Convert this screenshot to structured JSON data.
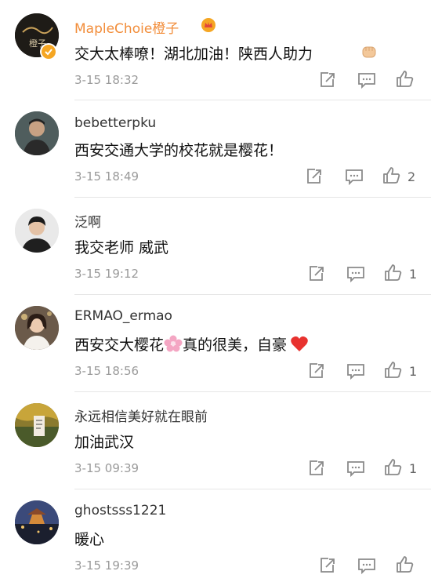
{
  "comments": [
    {
      "username": "MapleChoie橙子",
      "text": "交大太棒嘹！湖北加油！陕西人助力",
      "time": "3-15 18:32",
      "likes": ""
    },
    {
      "username": "bebetterpku",
      "text": "西安交通大学的校花就是樱花！",
      "time": "3-15 18:49",
      "likes": "2"
    },
    {
      "username": "泛啊",
      "text": "我交老师 威武",
      "time": "3-15 19:12",
      "likes": "1"
    },
    {
      "username": "ERMAO_ermao",
      "text_before": "西安交大樱花",
      "text_after": "真的很美，自豪",
      "time": "3-15 18:56",
      "likes": "1"
    },
    {
      "username": "永远相信美好就在眼前",
      "text": "加油武汉",
      "time": "3-15 09:39",
      "likes": "1"
    },
    {
      "username": "ghostsss1221",
      "text": "暖心",
      "time": "3-15 19:39",
      "likes": ""
    }
  ],
  "colors": {
    "vip_name": "#f28d3a",
    "icon": "#8a8a8a",
    "heart": "#e8322f"
  }
}
